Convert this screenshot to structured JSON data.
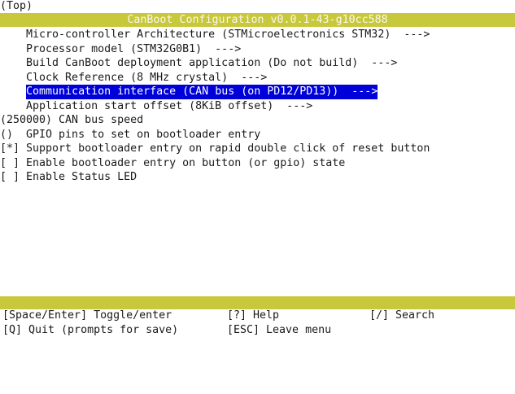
{
  "screen": {
    "top_indicator": "(Top)",
    "title": "CanBoot Configuration v0.0.1-43-g10cc588"
  },
  "menu": {
    "items": [
      {
        "text": "    Micro-controller Architecture (STMicroelectronics STM32)  --->",
        "selected": false
      },
      {
        "text": "    Processor model (STM32G0B1)  --->",
        "selected": false
      },
      {
        "text": "    Build CanBoot deployment application (Do not build)  --->",
        "selected": false
      },
      {
        "text": "    Clock Reference (8 MHz crystal)  --->",
        "selected": false
      },
      {
        "indent": "    ",
        "text": "Communication interface (CAN bus (on PD12/PD13))  --->",
        "selected": true
      },
      {
        "text": "    Application start offset (8KiB offset)  --->",
        "selected": false
      },
      {
        "text": "(250000) CAN bus speed",
        "selected": false
      },
      {
        "text": "()  GPIO pins to set on bootloader entry",
        "selected": false
      },
      {
        "text": "[*] Support bootloader entry on rapid double click of reset button",
        "selected": false
      },
      {
        "text": "[ ] Enable bootloader entry on button (or gpio) state",
        "selected": false
      },
      {
        "text": "[ ] Enable Status LED",
        "selected": false
      }
    ]
  },
  "help": {
    "row1": [
      "[Space/Enter] Toggle/enter",
      "[?] Help",
      "[/] Search"
    ],
    "row2": [
      "[Q] Quit (prompts for save)",
      "[ESC] Leave menu",
      ""
    ]
  },
  "colors": {
    "bar_yellow": "#c8c83c",
    "selection_blue": "#0000d8",
    "background": "#ffffff",
    "text": "#1a1a1a"
  }
}
